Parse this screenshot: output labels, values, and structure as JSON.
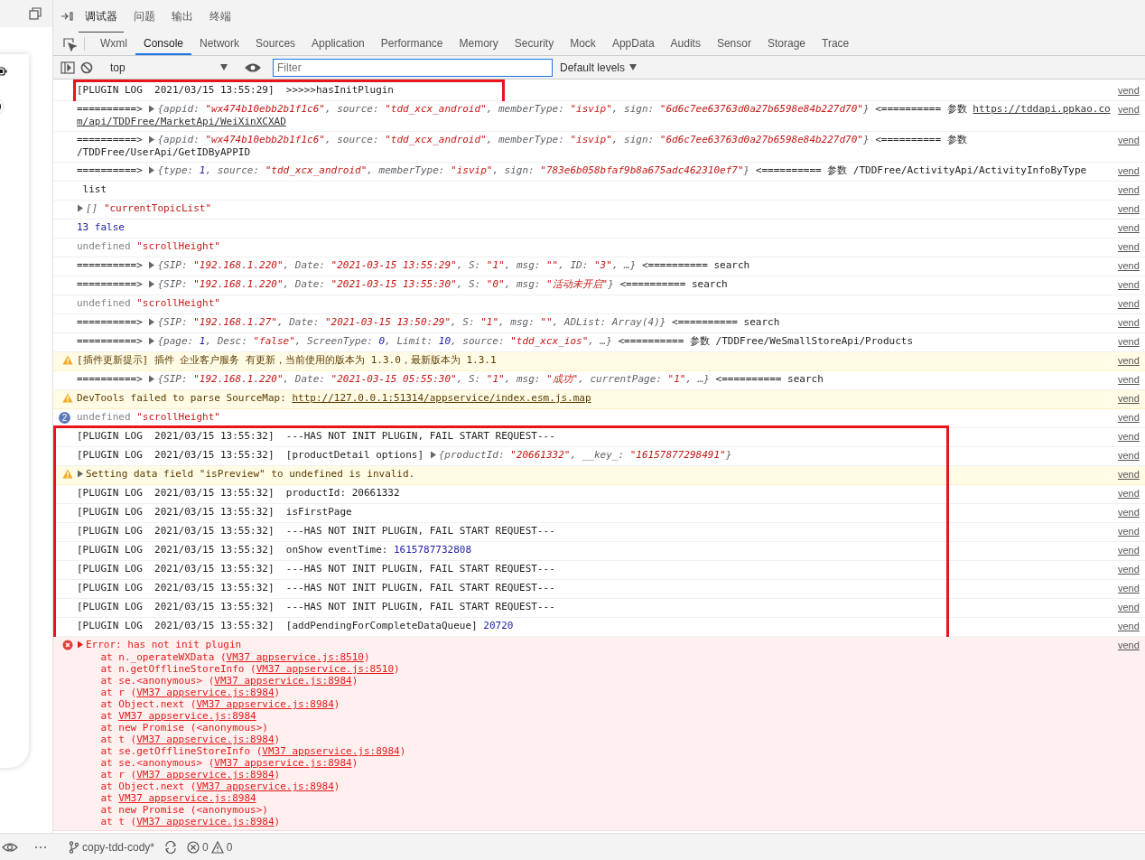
{
  "panel_tabs": [
    {
      "label": "调试器",
      "selected": true
    },
    {
      "label": "问题",
      "selected": false
    },
    {
      "label": "输出",
      "selected": false
    },
    {
      "label": "终端",
      "selected": false
    }
  ],
  "devtools_tabs": [
    {
      "label": "Wxml",
      "selected": false
    },
    {
      "label": "Console",
      "selected": true
    },
    {
      "label": "Network",
      "selected": false
    },
    {
      "label": "Sources",
      "selected": false
    },
    {
      "label": "Application",
      "selected": false
    },
    {
      "label": "Performance",
      "selected": false
    },
    {
      "label": "Memory",
      "selected": false
    },
    {
      "label": "Security",
      "selected": false
    },
    {
      "label": "Mock",
      "selected": false
    },
    {
      "label": "AppData",
      "selected": false
    },
    {
      "label": "Audits",
      "selected": false
    },
    {
      "label": "Sensor",
      "selected": false
    },
    {
      "label": "Storage",
      "selected": false
    },
    {
      "label": "Trace",
      "selected": false
    }
  ],
  "toolbar": {
    "context": "top",
    "filter": {
      "placeholder": "Filter"
    },
    "levels": "Default levels"
  },
  "log_groups": [
    {
      "boxed": true,
      "rows": [
        {
          "kind": "log",
          "source": "vend",
          "lines": [
            [
              {
                "kind": "p",
                "text": "[PLUGIN LOG  2021/03/15 13:55:29]  >>>>>hasInitPlugin"
              }
            ]
          ]
        }
      ]
    },
    {
      "boxed": false,
      "rows": [
        {
          "kind": "log",
          "source": "vend",
          "lines": [
            [
              {
                "kind": "p",
                "text": "==========> "
              },
              {
                "kind": "toggle"
              },
              {
                "kind": "k",
                "text": "{appid: "
              },
              {
                "kind": "s",
                "text": "\"wx474b10ebb2b1f1c6\""
              },
              {
                "kind": "k",
                "text": ", source: "
              },
              {
                "kind": "s",
                "text": "\"tdd_xcx_android\""
              },
              {
                "kind": "k",
                "text": ", memberType: "
              },
              {
                "kind": "s",
                "text": "\"isvip\""
              },
              {
                "kind": "k",
                "text": ", sign: "
              },
              {
                "kind": "s",
                "text": "\"6d6c7ee63763d0a27b6598e84b227d70\""
              },
              {
                "kind": "k",
                "text": "}"
              },
              {
                "kind": "p",
                "text": " <========== 参数 "
              },
              {
                "kind": "l",
                "text": "https://tddapi.ppkao.co"
              }
            ],
            [
              {
                "kind": "l",
                "text": "m/api/TDDFree/MarketApi/WeiXinXCXAD"
              }
            ]
          ]
        },
        {
          "kind": "log",
          "source": "vend",
          "lines": [
            [
              {
                "kind": "p",
                "text": "==========> "
              },
              {
                "kind": "toggle"
              },
              {
                "kind": "k",
                "text": "{appid: "
              },
              {
                "kind": "s",
                "text": "\"wx474b10ebb2b1f1c6\""
              },
              {
                "kind": "k",
                "text": ", source: "
              },
              {
                "kind": "s",
                "text": "\"tdd_xcx_android\""
              },
              {
                "kind": "k",
                "text": ", memberType: "
              },
              {
                "kind": "s",
                "text": "\"isvip\""
              },
              {
                "kind": "k",
                "text": ", sign: "
              },
              {
                "kind": "s",
                "text": "\"6d6c7ee63763d0a27b6598e84b227d70\""
              },
              {
                "kind": "k",
                "text": "}"
              },
              {
                "kind": "p",
                "text": " <========== 参数"
              }
            ],
            [
              {
                "kind": "p",
                "text": "/TDDFree/UserApi/GetIDByAPPID"
              }
            ]
          ]
        },
        {
          "kind": "log",
          "source": "vend",
          "lines": [
            [
              {
                "kind": "p",
                "text": "==========> "
              },
              {
                "kind": "toggle"
              },
              {
                "kind": "k",
                "text": "{type: "
              },
              {
                "kind": "n",
                "text": "1"
              },
              {
                "kind": "k",
                "text": ", source: "
              },
              {
                "kind": "s",
                "text": "\"tdd_xcx_android\""
              },
              {
                "kind": "k",
                "text": ", memberType: "
              },
              {
                "kind": "s",
                "text": "\"isvip\""
              },
              {
                "kind": "k",
                "text": ", sign: "
              },
              {
                "kind": "s",
                "text": "\"783e6b058bfaf9b8a675adc462310ef7\""
              },
              {
                "kind": "k",
                "text": "}"
              },
              {
                "kind": "p",
                "text": " <========== 参数 /TDDFree/ActivityApi/ActivityInfoByType"
              }
            ]
          ]
        },
        {
          "kind": "log",
          "source": "vend",
          "lines": [
            [
              {
                "kind": "p",
                "text": " list"
              }
            ]
          ]
        },
        {
          "kind": "log",
          "source": "vend",
          "lines": [
            [
              {
                "kind": "toggle"
              },
              {
                "kind": "k",
                "text": "[] "
              },
              {
                "kind": "q",
                "text": "\"currentTopicList\""
              }
            ]
          ]
        },
        {
          "kind": "log",
          "source": "vend",
          "lines": [
            [
              {
                "kind": "v",
                "text": "13 false"
              }
            ]
          ]
        },
        {
          "kind": "log",
          "source": "vend",
          "lines": [
            [
              {
                "kind": "g",
                "text": "undefined "
              },
              {
                "kind": "q",
                "text": "\"scrollHeight\""
              }
            ]
          ]
        },
        {
          "kind": "log",
          "source": "vend",
          "lines": [
            [
              {
                "kind": "p",
                "text": "==========> "
              },
              {
                "kind": "toggle"
              },
              {
                "kind": "k",
                "text": "{SIP: "
              },
              {
                "kind": "s",
                "text": "\"192.168.1.220\""
              },
              {
                "kind": "k",
                "text": ", Date: "
              },
              {
                "kind": "s",
                "text": "\"2021-03-15 13:55:29\""
              },
              {
                "kind": "k",
                "text": ", S: "
              },
              {
                "kind": "s",
                "text": "\"1\""
              },
              {
                "kind": "k",
                "text": ", msg: "
              },
              {
                "kind": "s",
                "text": "\"\""
              },
              {
                "kind": "k",
                "text": ", ID: "
              },
              {
                "kind": "s",
                "text": "\"3\""
              },
              {
                "kind": "k",
                "text": ", …}"
              },
              {
                "kind": "p",
                "text": " <========== search"
              }
            ]
          ]
        },
        {
          "kind": "log",
          "source": "vend",
          "lines": [
            [
              {
                "kind": "p",
                "text": "==========> "
              },
              {
                "kind": "toggle"
              },
              {
                "kind": "k",
                "text": "{SIP: "
              },
              {
                "kind": "s",
                "text": "\"192.168.1.220\""
              },
              {
                "kind": "k",
                "text": ", Date: "
              },
              {
                "kind": "s",
                "text": "\"2021-03-15 13:55:30\""
              },
              {
                "kind": "k",
                "text": ", S: "
              },
              {
                "kind": "s",
                "text": "\"0\""
              },
              {
                "kind": "k",
                "text": ", msg: "
              },
              {
                "kind": "s",
                "text": "\"活动未开启\""
              },
              {
                "kind": "k",
                "text": "}"
              },
              {
                "kind": "p",
                "text": " <========== search"
              }
            ]
          ]
        },
        {
          "kind": "log",
          "source": "vend",
          "lines": [
            [
              {
                "kind": "g",
                "text": "undefined "
              },
              {
                "kind": "q",
                "text": "\"scrollHeight\""
              }
            ]
          ]
        },
        {
          "kind": "log",
          "source": "vend",
          "lines": [
            [
              {
                "kind": "p",
                "text": "==========> "
              },
              {
                "kind": "toggle"
              },
              {
                "kind": "k",
                "text": "{SIP: "
              },
              {
                "kind": "s",
                "text": "\"192.168.1.27\""
              },
              {
                "kind": "k",
                "text": ", Date: "
              },
              {
                "kind": "s",
                "text": "\"2021-03-15 13:50:29\""
              },
              {
                "kind": "k",
                "text": ", S: "
              },
              {
                "kind": "s",
                "text": "\"1\""
              },
              {
                "kind": "k",
                "text": ", msg: "
              },
              {
                "kind": "s",
                "text": "\"\""
              },
              {
                "kind": "k",
                "text": ", ADList: Array(4)}"
              },
              {
                "kind": "p",
                "text": " <========== search"
              }
            ]
          ]
        },
        {
          "kind": "log",
          "source": "vend",
          "lines": [
            [
              {
                "kind": "p",
                "text": "==========> "
              },
              {
                "kind": "toggle"
              },
              {
                "kind": "k",
                "text": "{page: "
              },
              {
                "kind": "n",
                "text": "1"
              },
              {
                "kind": "k",
                "text": ", Desc: "
              },
              {
                "kind": "s",
                "text": "\"false\""
              },
              {
                "kind": "k",
                "text": ", ScreenType: "
              },
              {
                "kind": "n",
                "text": "0"
              },
              {
                "kind": "k",
                "text": ", Limit: "
              },
              {
                "kind": "n",
                "text": "10"
              },
              {
                "kind": "k",
                "text": ", source: "
              },
              {
                "kind": "s",
                "text": "\"tdd_xcx_ios\""
              },
              {
                "kind": "k",
                "text": ", …}"
              },
              {
                "kind": "p",
                "text": " <========== 参数 /TDDFree/WeSmallStoreApi/Products"
              }
            ]
          ]
        },
        {
          "kind": "warning",
          "source": "vend",
          "lines": [
            [
              {
                "kind": "w",
                "text": "[插件更新提示] 插件 企业客户服务 有更新，当前使用的版本为 1.3.0，最新版本为 1.3.1"
              }
            ]
          ]
        },
        {
          "kind": "log",
          "source": "vend",
          "lines": [
            [
              {
                "kind": "p",
                "text": "==========> "
              },
              {
                "kind": "toggle"
              },
              {
                "kind": "k",
                "text": "{SIP: "
              },
              {
                "kind": "s",
                "text": "\"192.168.1.220\""
              },
              {
                "kind": "k",
                "text": ", Date: "
              },
              {
                "kind": "s",
                "text": "\"2021-03-15 05:55:30\""
              },
              {
                "kind": "k",
                "text": ", S: "
              },
              {
                "kind": "s",
                "text": "\"1\""
              },
              {
                "kind": "k",
                "text": ", msg: "
              },
              {
                "kind": "s",
                "text": "\"成功\""
              },
              {
                "kind": "k",
                "text": ", currentPage: "
              },
              {
                "kind": "s",
                "text": "\"1\""
              },
              {
                "kind": "k",
                "text": ", …}"
              },
              {
                "kind": "p",
                "text": " <========== search"
              }
            ]
          ]
        },
        {
          "kind": "warning",
          "source": "vend",
          "lines": [
            [
              {
                "kind": "w",
                "text": "DevTools failed to parse SourceMap: "
              },
              {
                "kind": "wl",
                "text": "http://127.0.0.1:51314/appservice/index.esm.js.map"
              }
            ]
          ]
        },
        {
          "kind": "log",
          "source": "vend",
          "count": "2",
          "lines": [
            [
              {
                "kind": "g",
                "text": "undefined "
              },
              {
                "kind": "q",
                "text": "\"scrollHeight\""
              }
            ]
          ]
        }
      ]
    },
    {
      "boxed": true,
      "rows": [
        {
          "kind": "log",
          "source": "vend",
          "lines": [
            [
              {
                "kind": "p",
                "text": "[PLUGIN LOG  2021/03/15 13:55:32]  ---HAS NOT INIT PLUGIN, FAIL START REQUEST---"
              }
            ]
          ]
        },
        {
          "kind": "log",
          "source": "vend",
          "lines": [
            [
              {
                "kind": "p",
                "text": "[PLUGIN LOG  2021/03/15 13:55:32]  [productDetail options] "
              },
              {
                "kind": "toggle"
              },
              {
                "kind": "k",
                "text": "{productId: "
              },
              {
                "kind": "s",
                "text": "\"20661332\""
              },
              {
                "kind": "k",
                "text": ", __key_: "
              },
              {
                "kind": "s",
                "text": "\"16157877298491\""
              },
              {
                "kind": "k",
                "text": "}"
              }
            ]
          ]
        },
        {
          "kind": "warning",
          "source": "vend",
          "lines": [
            [
              {
                "kind": "toggle"
              },
              {
                "kind": "w",
                "text": "Setting data field \"isPreview\" to undefined is invalid."
              }
            ]
          ]
        },
        {
          "kind": "log",
          "source": "vend",
          "lines": [
            [
              {
                "kind": "p",
                "text": "[PLUGIN LOG  2021/03/15 13:55:32]  productId: 20661332"
              }
            ]
          ]
        },
        {
          "kind": "log",
          "source": "vend",
          "lines": [
            [
              {
                "kind": "p",
                "text": "[PLUGIN LOG  2021/03/15 13:55:32]  isFirstPage"
              }
            ]
          ]
        },
        {
          "kind": "log",
          "source": "vend",
          "lines": [
            [
              {
                "kind": "p",
                "text": "[PLUGIN LOG  2021/03/15 13:55:32]  ---HAS NOT INIT PLUGIN, FAIL START REQUEST---"
              }
            ]
          ]
        },
        {
          "kind": "log",
          "source": "vend",
          "lines": [
            [
              {
                "kind": "p",
                "text": "[PLUGIN LOG  2021/03/15 13:55:32]  onShow eventTime: "
              },
              {
                "kind": "v",
                "text": "1615787732808"
              }
            ]
          ]
        },
        {
          "kind": "log",
          "source": "vend",
          "lines": [
            [
              {
                "kind": "p",
                "text": "[PLUGIN LOG  2021/03/15 13:55:32]  ---HAS NOT INIT PLUGIN, FAIL START REQUEST---"
              }
            ]
          ]
        },
        {
          "kind": "log",
          "source": "vend",
          "lines": [
            [
              {
                "kind": "p",
                "text": "[PLUGIN LOG  2021/03/15 13:55:32]  ---HAS NOT INIT PLUGIN, FAIL START REQUEST---"
              }
            ]
          ]
        },
        {
          "kind": "log",
          "source": "vend",
          "lines": [
            [
              {
                "kind": "p",
                "text": "[PLUGIN LOG  2021/03/15 13:55:32]  ---HAS NOT INIT PLUGIN, FAIL START REQUEST---"
              }
            ]
          ]
        },
        {
          "kind": "log",
          "source": "vend",
          "lines": [
            [
              {
                "kind": "p",
                "text": "[PLUGIN LOG  2021/03/15 13:55:32]  [addPendingForCompleteDataQueue] "
              },
              {
                "kind": "v",
                "text": "20720"
              }
            ]
          ]
        }
      ]
    },
    {
      "boxed": false,
      "rows": [
        {
          "kind": "error",
          "source": "vend",
          "lines": [
            [
              {
                "kind": "toggle"
              },
              {
                "kind": "e",
                "text": "Error: has not init plugin"
              }
            ]
          ],
          "stack": [
            [
              {
                "kind": "e",
                "text": "    at n._operateWXData ("
              },
              {
                "kind": "el",
                "text": "VM37 appservice.js:8510"
              },
              {
                "kind": "e",
                "text": ")"
              }
            ],
            [
              {
                "kind": "e",
                "text": "    at n.getOfflineStoreInfo ("
              },
              {
                "kind": "el",
                "text": "VM37 appservice.js:8510"
              },
              {
                "kind": "e",
                "text": ")"
              }
            ],
            [
              {
                "kind": "e",
                "text": "    at se.<anonymous> ("
              },
              {
                "kind": "el",
                "text": "VM37 appservice.js:8984"
              },
              {
                "kind": "e",
                "text": ")"
              }
            ],
            [
              {
                "kind": "e",
                "text": "    at r ("
              },
              {
                "kind": "el",
                "text": "VM37 appservice.js:8984"
              },
              {
                "kind": "e",
                "text": ")"
              }
            ],
            [
              {
                "kind": "e",
                "text": "    at Object.next ("
              },
              {
                "kind": "el",
                "text": "VM37 appservice.js:8984"
              },
              {
                "kind": "e",
                "text": ")"
              }
            ],
            [
              {
                "kind": "e",
                "text": "    at "
              },
              {
                "kind": "el",
                "text": "VM37 appservice.js:8984"
              }
            ],
            [
              {
                "kind": "e",
                "text": "    at new Promise (<anonymous>)"
              }
            ],
            [
              {
                "kind": "e",
                "text": "    at t ("
              },
              {
                "kind": "el",
                "text": "VM37 appservice.js:8984"
              },
              {
                "kind": "e",
                "text": ")"
              }
            ],
            [
              {
                "kind": "e",
                "text": "    at se.getOfflineStoreInfo ("
              },
              {
                "kind": "el",
                "text": "VM37 appservice.js:8984"
              },
              {
                "kind": "e",
                "text": ")"
              }
            ],
            [
              {
                "kind": "e",
                "text": "    at se.<anonymous> ("
              },
              {
                "kind": "el",
                "text": "VM37 appservice.js:8984"
              },
              {
                "kind": "e",
                "text": ")"
              }
            ],
            [
              {
                "kind": "e",
                "text": "    at r ("
              },
              {
                "kind": "el",
                "text": "VM37 appservice.js:8984"
              },
              {
                "kind": "e",
                "text": ")"
              }
            ],
            [
              {
                "kind": "e",
                "text": "    at Object.next ("
              },
              {
                "kind": "el",
                "text": "VM37 appservice.js:8984"
              },
              {
                "kind": "e",
                "text": ")"
              }
            ],
            [
              {
                "kind": "e",
                "text": "    at "
              },
              {
                "kind": "el",
                "text": "VM37 appservice.js:8984"
              }
            ],
            [
              {
                "kind": "e",
                "text": "    at new Promise (<anonymous>)"
              }
            ],
            [
              {
                "kind": "e",
                "text": "    at t ("
              },
              {
                "kind": "el",
                "text": "VM37 appservice.js:8984"
              },
              {
                "kind": "e",
                "text": ")"
              }
            ]
          ]
        }
      ]
    }
  ],
  "status_bar": {
    "branch": "copy-tdd-cody*",
    "errors": "0",
    "warnings": "0"
  }
}
